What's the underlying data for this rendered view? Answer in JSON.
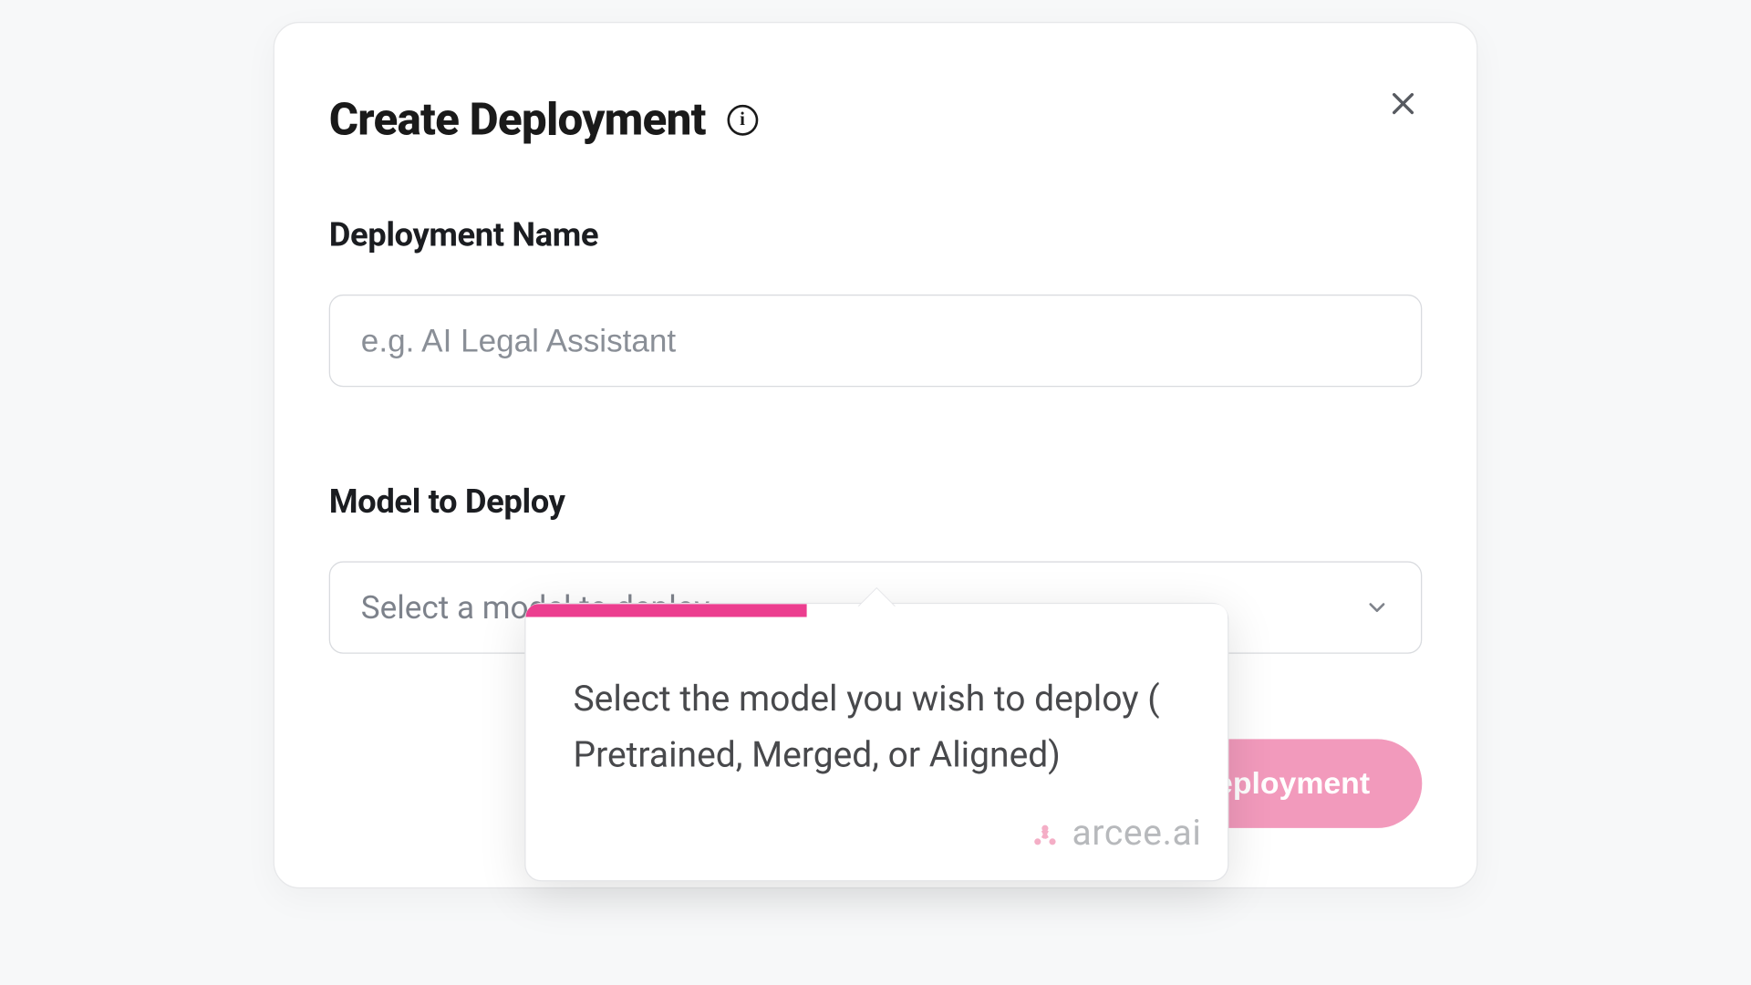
{
  "modal": {
    "title": "Create Deployment",
    "close_aria": "Close"
  },
  "name_field": {
    "label": "Deployment Name",
    "placeholder": "e.g. AI Legal Assistant",
    "value": ""
  },
  "model_field": {
    "label": "Model to Deploy",
    "placeholder": "Select a model to deploy"
  },
  "submit": {
    "label": "Create Deployment"
  },
  "tooltip": {
    "text": "Select the model you wish to deploy ( Pretrained, Merged, or Aligned)",
    "progress_pct": 40,
    "brand": "arcee.ai"
  },
  "colors": {
    "accent_pink": "#ec3e8f",
    "button_pink": "#f29abc",
    "brand_pink": "#f4aec6"
  }
}
